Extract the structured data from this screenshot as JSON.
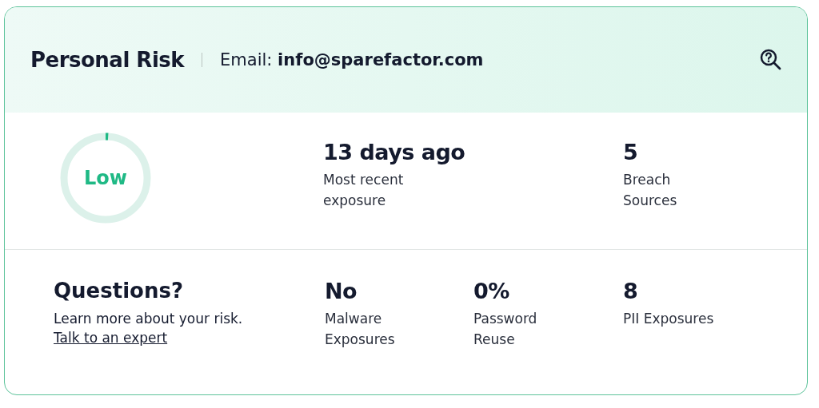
{
  "header": {
    "title": "Personal Risk",
    "email_label": "Email:",
    "email": "info@sparefactor.com"
  },
  "risk": {
    "label": "Low",
    "level": 0.01
  },
  "top_stats": [
    {
      "value": "13 days ago",
      "label": "Most recent exposure"
    },
    {
      "value": "5",
      "label": "Breach Sources"
    }
  ],
  "questions": {
    "title": "Questions?",
    "text": "Learn more about your risk.",
    "link": "Talk to an expert"
  },
  "bottom_stats": [
    {
      "value": "No",
      "label": "Malware Exposures"
    },
    {
      "value": "0%",
      "label": "Password Reuse"
    },
    {
      "value": "8",
      "label": "PII Exposures"
    }
  ]
}
